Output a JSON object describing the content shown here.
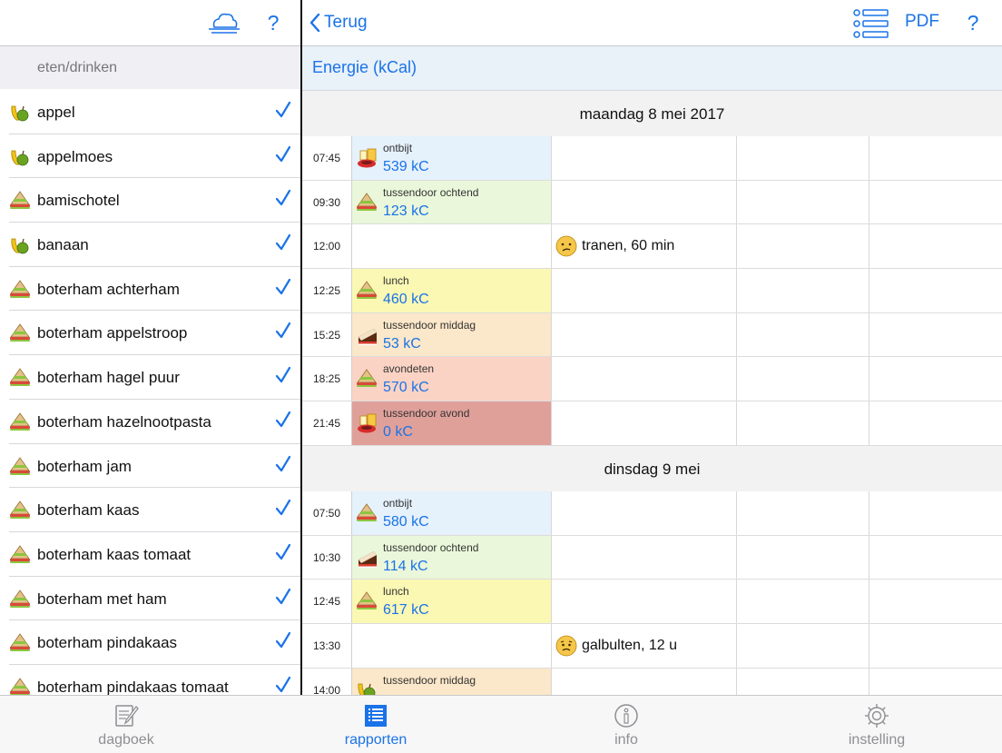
{
  "left": {
    "help_label": "?",
    "section_header": "eten/drinken",
    "items": [
      {
        "label": "appel",
        "icon": "fruit-icon"
      },
      {
        "label": "appelmoes",
        "icon": "fruit-icon"
      },
      {
        "label": "bamischotel",
        "icon": "sandwich-icon"
      },
      {
        "label": "banaan",
        "icon": "fruit-icon"
      },
      {
        "label": "boterham achterham",
        "icon": "sandwich-icon"
      },
      {
        "label": "boterham appelstroop",
        "icon": "sandwich-icon"
      },
      {
        "label": "boterham hagel puur",
        "icon": "sandwich-icon"
      },
      {
        "label": "boterham hazelnootpasta",
        "icon": "sandwich-icon"
      },
      {
        "label": "boterham jam",
        "icon": "sandwich-icon"
      },
      {
        "label": "boterham kaas",
        "icon": "sandwich-icon"
      },
      {
        "label": "boterham kaas tomaat",
        "icon": "sandwich-icon"
      },
      {
        "label": "boterham met ham",
        "icon": "sandwich-icon"
      },
      {
        "label": "boterham pindakaas",
        "icon": "sandwich-icon"
      },
      {
        "label": "boterham pindakaas tomaat",
        "icon": "sandwich-icon"
      }
    ]
  },
  "right": {
    "back_label": "Terug",
    "pdf_label": "PDF",
    "help_label": "?",
    "metric_title": "Energie (kCal)",
    "days": [
      {
        "title": "maandag 8 mei 2017",
        "entries": [
          {
            "time": "07:45",
            "meal": "ontbijt",
            "kcal": "539 kC",
            "icon": "breakfast-icon",
            "color": "#e5f1fb"
          },
          {
            "time": "09:30",
            "meal": "tussendoor ochtend",
            "kcal": "123 kC",
            "icon": "sandwich-icon",
            "color": "#eaf7da"
          },
          {
            "time": "12:00",
            "symptom": "tranen, 60 min",
            "face": "sad-face-icon"
          },
          {
            "time": "12:25",
            "meal": "lunch",
            "kcal": "460 kC",
            "icon": "sandwich-icon",
            "color": "#fbf8b4"
          },
          {
            "time": "15:25",
            "meal": "tussendoor middag",
            "kcal": "53 kC",
            "icon": "cake-icon",
            "color": "#fbe7c9"
          },
          {
            "time": "18:25",
            "meal": "avondeten",
            "kcal": "570 kC",
            "icon": "sandwich-icon",
            "color": "#fbd3c4"
          },
          {
            "time": "21:45",
            "meal": "tussendoor avond",
            "kcal": "0 kC",
            "icon": "breakfast-icon",
            "color": "#e0a09a"
          }
        ]
      },
      {
        "title": "dinsdag 9 mei",
        "entries": [
          {
            "time": "07:50",
            "meal": "ontbijt",
            "kcal": "580 kC",
            "icon": "sandwich-icon",
            "color": "#e5f1fb"
          },
          {
            "time": "10:30",
            "meal": "tussendoor ochtend",
            "kcal": "114 kC",
            "icon": "cake-icon",
            "color": "#eaf7da"
          },
          {
            "time": "12:45",
            "meal": "lunch",
            "kcal": "617 kC",
            "icon": "sandwich-icon",
            "color": "#fbf8b4"
          },
          {
            "time": "13:30",
            "symptom": "galbulten, 12 u",
            "face": "worried-face-icon"
          },
          {
            "time": "14:00",
            "meal": "tussendoor middag",
            "kcal": "",
            "icon": "fruit-icon",
            "color": "#fbe7c9"
          }
        ]
      }
    ]
  },
  "tabs": [
    {
      "label": "dagboek",
      "icon": "notebook-icon",
      "active": false
    },
    {
      "label": "rapporten",
      "icon": "report-list-icon",
      "active": true
    },
    {
      "label": "info",
      "icon": "info-icon",
      "active": false
    },
    {
      "label": "instelling",
      "icon": "gear-icon",
      "active": false
    }
  ],
  "colors": {
    "accent": "#1a73e8",
    "inactive": "#8e8e93",
    "check": "#1a73e8"
  }
}
